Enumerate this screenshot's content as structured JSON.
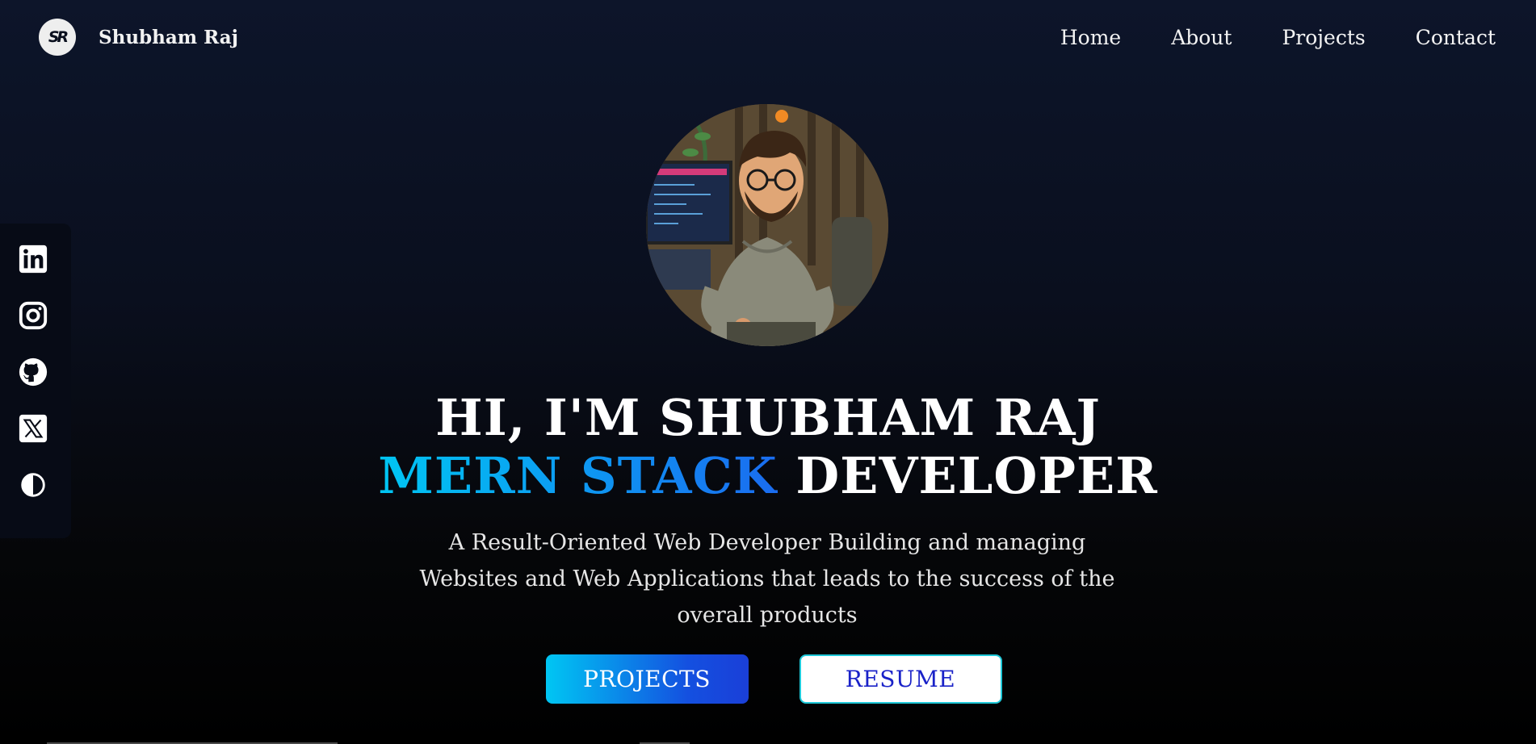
{
  "navbar": {
    "logo_text": "SR",
    "brand_name": "Shubham Raj",
    "links": [
      {
        "label": "Home"
      },
      {
        "label": "About"
      },
      {
        "label": "Projects"
      },
      {
        "label": "Contact"
      }
    ]
  },
  "social": {
    "icons": [
      "linkedin-icon",
      "instagram-icon",
      "github-icon",
      "x-twitter-icon",
      "theme-toggle-icon"
    ]
  },
  "hero": {
    "title": "HI, I'M SHUBHAM RAJ",
    "subtitle_accent": "MERN STACK",
    "subtitle_rest": " DEVELOPER",
    "description": "A Result-Oriented Web Developer Building and managing Websites and Web Applications that leads to the success of the overall products",
    "projects_button": "PROJECTS",
    "resume_button": "RESUME"
  },
  "colors": {
    "accent_start": "#00c6f3",
    "accent_end": "#1a3fd8",
    "resume_text": "#1a22c8"
  }
}
